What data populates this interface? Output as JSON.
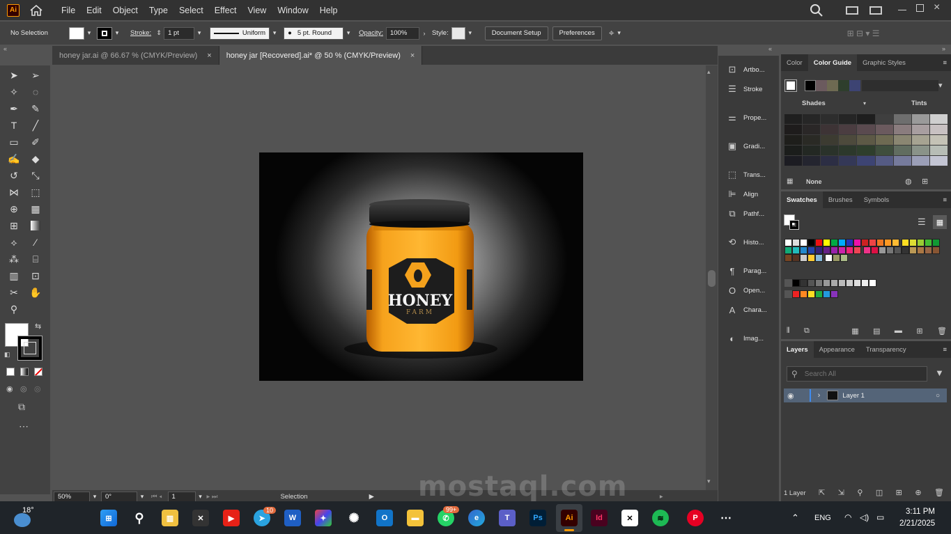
{
  "app": {
    "logo": "Ai"
  },
  "menu": [
    "File",
    "Edit",
    "Object",
    "Type",
    "Select",
    "Effect",
    "View",
    "Window",
    "Help"
  ],
  "control": {
    "selection": "No Selection",
    "stroke_label": "Stroke:",
    "stroke_weight": "1 pt",
    "profile": "Uniform",
    "brush": "5 pt. Round",
    "opacity_label": "Opacity:",
    "opacity": "100%",
    "style_label": "Style:",
    "doc_setup": "Document Setup",
    "preferences": "Preferences"
  },
  "tabs": [
    {
      "label": "honey jar.ai @ 66.67 % (CMYK/Preview)",
      "active": false
    },
    {
      "label": "honey jar [Recovered].ai* @ 50 % (CMYK/Preview)",
      "active": true
    }
  ],
  "tab_close": "×",
  "artwork": {
    "brand": "HONEY",
    "sub": "FARM"
  },
  "status": {
    "zoom": "50%",
    "rotation": "0°",
    "artboard": "1",
    "tool": "Selection"
  },
  "dock": [
    "Artbo...",
    "Stroke",
    "Prope...",
    "Gradi...",
    "Trans...",
    "Align",
    "Pathf...",
    "Histo...",
    "Parag...",
    "Open...",
    "Chara...",
    "Imag..."
  ],
  "color_panel": {
    "tabs": [
      "Color",
      "Color Guide",
      "Graphic Styles"
    ],
    "shades": "Shades",
    "tints": "Tints",
    "none": "None"
  },
  "swatches_panel": {
    "tabs": [
      "Swatches",
      "Brushes",
      "Symbols"
    ]
  },
  "layers_panel": {
    "tabs": [
      "Layers",
      "Appearance",
      "Transparency"
    ],
    "search_placeholder": "Search All",
    "layer_name": "Layer 1",
    "count": "1 Layer"
  },
  "taskbar": {
    "temp": "18°",
    "lang": "ENG",
    "time": "3:11 PM",
    "date": "2/21/2025",
    "badge_telegram": "10",
    "badge_whatsapp": "99+"
  },
  "watermark": {
    "text": "mostaql.com"
  }
}
